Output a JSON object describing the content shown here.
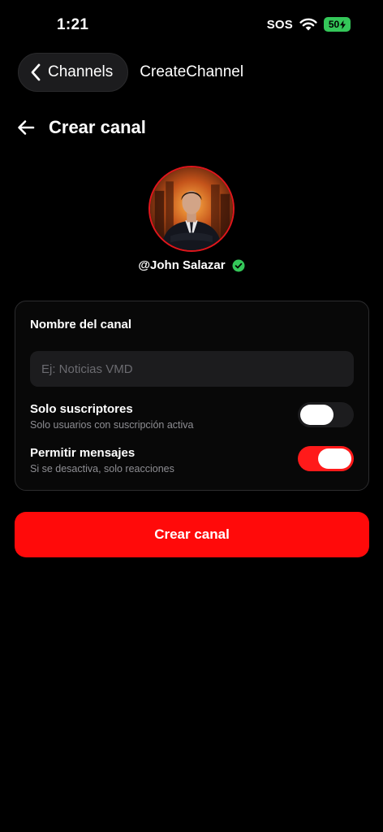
{
  "status_bar": {
    "time": "1:21",
    "sos": "SOS",
    "battery": "50",
    "battery_color": "#34c759"
  },
  "nav": {
    "back_label": "Channels",
    "title": "CreateChannel"
  },
  "page": {
    "title": "Crear canal"
  },
  "profile": {
    "handle": "@John Salazar",
    "verified_color": "#34c759",
    "avatar_border_color": "#e0161c"
  },
  "form": {
    "name_label": "Nombre del canal",
    "name_value": "",
    "name_placeholder": "Ej: Noticias VMD",
    "toggles": [
      {
        "title": "Solo suscriptores",
        "subtitle": "Solo usuarios con suscripción activa",
        "on": false
      },
      {
        "title": "Permitir mensajes",
        "subtitle": "Si se desactiva, solo reacciones",
        "on": true
      }
    ]
  },
  "submit": {
    "label": "Crear canal",
    "color": "#ff0a0a"
  },
  "icons": [
    "wifi-icon",
    "battery-bolt-icon",
    "chevron-left-icon",
    "arrow-left-icon",
    "verified-check-icon"
  ]
}
